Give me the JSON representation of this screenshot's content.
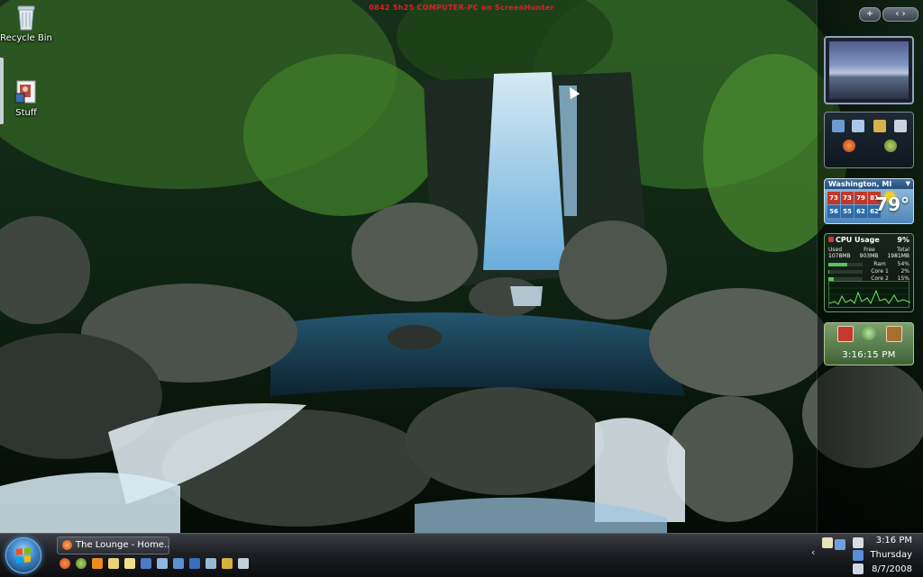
{
  "banner": "0842 5h25 COMPUTER-PC on ScreenHunter",
  "desktop": {
    "icons": [
      {
        "label": "Recycle Bin",
        "icon": "recycle-bin-icon"
      },
      {
        "label": "Stuff",
        "icon": "folder-icon"
      }
    ]
  },
  "sidebar": {
    "controls": {
      "add": "+",
      "nav": "‹ ›"
    },
    "weather": {
      "location": "Washington, MI",
      "current_temp": "79°",
      "highs": [
        "73",
        "73",
        "79",
        "81"
      ],
      "lows": [
        "56",
        "55",
        "62",
        "62"
      ]
    },
    "cpu": {
      "title": "CPU Usage",
      "percent": "9%",
      "columns": [
        "Used",
        "Free",
        "Total"
      ],
      "values": [
        "1078MB",
        "903MB",
        "1981MB"
      ],
      "rows": [
        {
          "label": "Ram",
          "pct": "54%",
          "fill": 54
        },
        {
          "label": "Core 1",
          "pct": "2%",
          "fill": 2
        },
        {
          "label": "Core 2",
          "pct": "15%",
          "fill": 15
        }
      ]
    },
    "clock": {
      "time": "3:16:15 PM"
    }
  },
  "taskbar": {
    "task_button": "The Lounge - Home...",
    "tray": {
      "time": "3:16 PM",
      "day": "Thursday",
      "date": "8/7/2008"
    }
  },
  "colors": {
    "accent": "#3b84c8",
    "weather_high": "#c0392b",
    "weather_low": "#2e6aa6",
    "cpu_green": "#58c45a"
  }
}
